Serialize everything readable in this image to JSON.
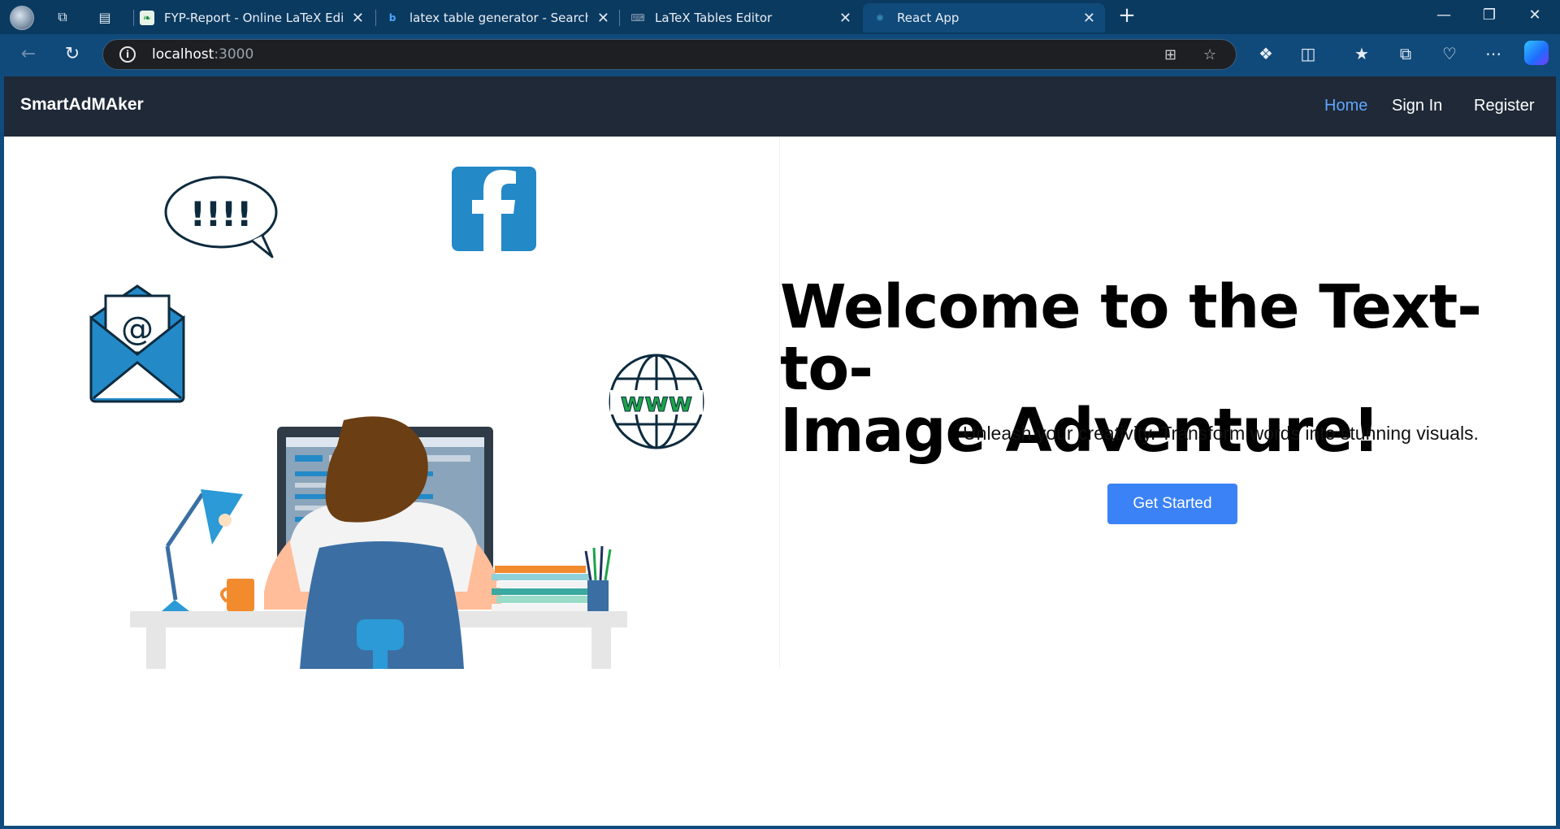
{
  "browser": {
    "tabs": [
      {
        "title": "FYP-Report - Online LaTeX Editor",
        "favicon": "overleaf-icon"
      },
      {
        "title": "latex table generator - Search",
        "favicon": "bing-icon"
      },
      {
        "title": "LaTeX Tables Editor",
        "favicon": "keyboard-icon"
      },
      {
        "title": "React App",
        "favicon": "react-icon"
      }
    ],
    "address": {
      "host": "localhost",
      "port": ":3000"
    }
  },
  "app": {
    "brand": "SmartAdMAker",
    "nav": {
      "home": "Home",
      "signin": "Sign In",
      "register": "Register"
    },
    "hero": {
      "title_line1": "Welcome to the Text-to-",
      "title_line2": "Image Adventure!",
      "subtitle": "Unleash your creativity. Transform words into stunning visuals.",
      "cta": "Get Started"
    },
    "illustration": {
      "speech_bubble_text": "!!!!",
      "globe_text": "www",
      "email_text": "@"
    }
  },
  "colors": {
    "nav_bg": "#1f2937",
    "active_link": "#60a5fa",
    "cta_bg": "#3b82f6",
    "illustration_blue": "#2389c7"
  }
}
